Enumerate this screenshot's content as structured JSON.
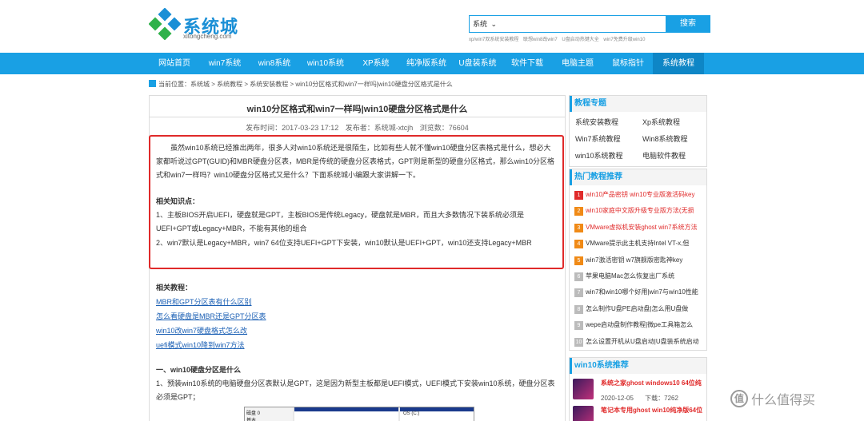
{
  "site": {
    "logo_text": "系统城",
    "logo_sub": "xitongcheng.com"
  },
  "search": {
    "select_value": "系统",
    "select_caret": "⌄",
    "button_label": "搜索",
    "hot_words": [
      "xp/win7双系统安装教程",
      "联想win8改win7",
      "U盘启动热键大全",
      "win7免费升级win10"
    ]
  },
  "nav": {
    "items": [
      "网站首页",
      "win7系统",
      "win8系统",
      "win10系统",
      "XP系统",
      "纯净版系统",
      "U盘装系统",
      "软件下载",
      "电脑主题",
      "鼠标指针",
      "系统教程"
    ],
    "active_index": 10
  },
  "breadcrumb": {
    "prefix": "当前位置：",
    "parts": [
      "系统城",
      "系统教程",
      "系统安装教程",
      "win10分区格式和win7一样吗|win10硬盘分区格式是什么"
    ],
    "separator": " > "
  },
  "article": {
    "title": "win10分区格式和win7一样吗|win10硬盘分区格式是什么",
    "publish_time": "发布时间：2017-03-23 17:12",
    "author": "发布者：系统城-xtcjh",
    "views": "浏览数：76604",
    "intro": "虽然win10系统已经推出两年，很多人对win10系统还是很陌生，比如有些人就不懂win10硬盘分区表格式是什么，想必大家都听说过GPT(GUID)和MBR硬盘分区表，MBR是传统的硬盘分区表格式，GPT则是新型的硬盘分区格式，那么win10分区格式和win7一样吗？win10硬盘分区格式又是什么？下面系统城小编跟大家讲解一下。",
    "knowledge_title": "相关知识点：",
    "knowledge_1": "1、主板BIOS开启UEFI，硬盘就是GPT，主板BIOS是传统Legacy，硬盘就是MBR，而且大多数情况下装系统必须是UEFI+GPT或Legacy+MBR，不能有其他的组合",
    "knowledge_2": "2、win7默认是Legacy+MBR，win7 64位支持UEFI+GPT下安装，win10默认是UEFI+GPT，win10还支持Legacy+MBR",
    "related_title": "相关教程：",
    "related_links": [
      "MBR和GPT分区表有什么区别",
      "怎么看硬盘是MBR还是GPT分区表",
      "win10改win7硬盘格式怎么改",
      "uefi模式win10降到win7方法"
    ],
    "section_title": "一、win10硬盘分区是什么",
    "section_text": "1、预装win10系统的电脑硬盘分区表默认是GPT，这是因为新型主板都是UEFI模式，UEFI模式下安装win10系统，硬盘分区表必须是GPT；",
    "disk_label": "磁盘 0",
    "disk_sub": "基本",
    "disk_part": "OS (C:)"
  },
  "sidebar": {
    "courses_title": "教程专题",
    "courses": [
      "系统安装教程",
      "Xp系统教程",
      "Win7系统教程",
      "Win8系统教程",
      "win10系统教程",
      "电脑软件教程"
    ],
    "hot_title": "热门教程推荐",
    "hot_items": [
      "win10产品密钥 win10专业版激活码key",
      "win10家庭中文版升级专业版方法(无损",
      "VMware虚拟机安装ghost win7系统方法",
      "VMware提示此主机支持Intel VT-x,但",
      "win7激活密钥 w7旗舰版密匙神key",
      "苹果电脑Mac怎么恢复出厂系统",
      "win7和win10哪个好用|win7与win10性能",
      "怎么制作U盘PE启动盘|怎么用U盘做",
      "wepe启动盘制作教程|微pe工具箱怎么",
      "怎么设置开机从U盘启动|U盘装系统启动"
    ],
    "sys_title": "win10系统推荐",
    "sys_items": [
      {
        "name": "系统之家ghost windows10 64位纯",
        "date": "2020-12-05",
        "downloads_label": "下载：",
        "downloads": "7262"
      },
      {
        "name": "笔记本专用ghost win10纯净版64位",
        "date": "",
        "downloads_label": "",
        "downloads": ""
      }
    ]
  },
  "watermark": {
    "badge": "值",
    "text": "什么值得买"
  },
  "colors": {
    "brand_blue": "#19a0e4",
    "highlight_red": "#e02a2a",
    "link_blue": "#1a5fb4"
  }
}
